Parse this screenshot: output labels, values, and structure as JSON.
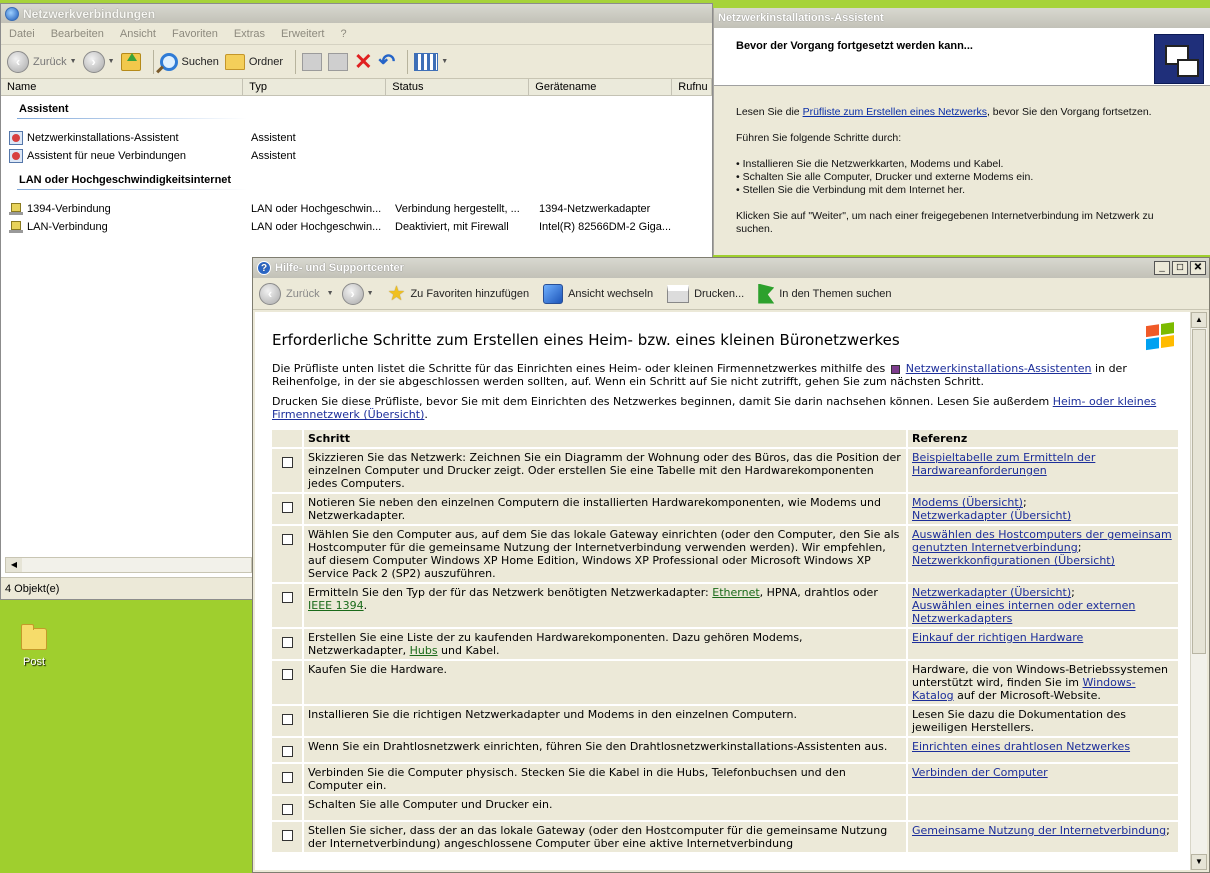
{
  "explorer": {
    "title": "Netzwerkverbindungen",
    "menu": [
      "Datei",
      "Bearbeiten",
      "Ansicht",
      "Favoriten",
      "Extras",
      "Erweitert",
      "?"
    ],
    "toolbar": {
      "back": "Zurück",
      "search": "Suchen",
      "folders": "Ordner"
    },
    "columns": [
      "Name",
      "Typ",
      "Status",
      "Gerätename",
      "Rufnu"
    ],
    "groups": [
      {
        "title": "Assistent",
        "items": [
          {
            "name": "Netzwerkinstallations-Assistent",
            "type": "Assistent",
            "status": "",
            "device": ""
          },
          {
            "name": "Assistent für neue Verbindungen",
            "type": "Assistent",
            "status": "",
            "device": ""
          }
        ]
      },
      {
        "title": "LAN oder Hochgeschwindigkeitsinternet",
        "items": [
          {
            "name": "1394-Verbindung",
            "type": "LAN oder Hochgeschwin...",
            "status": "Verbindung hergestellt, ...",
            "device": "1394-Netzwerkadapter"
          },
          {
            "name": "LAN-Verbindung",
            "type": "LAN oder Hochgeschwin...",
            "status": "Deaktiviert, mit Firewall",
            "device": "Intel(R) 82566DM-2 Giga..."
          }
        ]
      }
    ],
    "status": "4 Objekt(e)"
  },
  "desktop": {
    "icon_label": "Post"
  },
  "wizard": {
    "title": "Netzwerkinstallations-Assistent",
    "header": "Bevor der Vorgang fortgesetzt werden kann...",
    "p1_pre": "Lesen Sie die ",
    "p1_link": "Prüfliste zum Erstellen eines Netzwerks",
    "p1_post": ", bevor Sie den Vorgang fortsetzen.",
    "p2": "Führen Sie folgende Schritte durch:",
    "bullets": [
      "Installieren Sie die Netzwerkkarten, Modems und Kabel.",
      "Schalten Sie alle Computer, Drucker und externe Modems ein.",
      "Stellen Sie die Verbindung mit dem Internet her."
    ],
    "p3": "Klicken Sie auf \"Weiter\", um nach einer freigegebenen Internetverbindung im Netzwerk zu suchen."
  },
  "help": {
    "title": "Hilfe- und Supportcenter",
    "toolbar": {
      "back": "Zurück",
      "favorites": "Zu Favoriten hinzufügen",
      "switch_view": "Ansicht wechseln",
      "print": "Drucken...",
      "find_topics": "In den Themen suchen"
    },
    "heading": "Erforderliche Schritte zum Erstellen eines Heim- bzw. eines kleinen Büronetzwerkes",
    "intro_pre": "Die Prüfliste unten listet die Schritte für das Einrichten eines Heim- oder kleinen Firmennetzwerkes mithilfe des",
    "intro_link": "Netzwerkinstallations-Assistenten",
    "intro_post": "in der Reihenfolge, in der sie abgeschlossen werden sollten, auf. Wenn ein Schritt auf Sie nicht zutrifft, gehen Sie zum nächsten Schritt.",
    "print_pre": "Drucken Sie diese Prüfliste, bevor Sie mit dem Einrichten des Netzwerkes beginnen, damit Sie darin nachsehen können. Lesen Sie außerdem",
    "print_link": "Heim- oder kleines Firmennetzwerk (Übersicht)",
    "print_post": ".",
    "table": {
      "col_step": "Schritt",
      "col_ref": "Referenz",
      "rows": [
        {
          "step": [
            "Skizzieren Sie das Netzwerk: Zeichnen Sie ein Diagramm der Wohnung oder des Büros, das die Position der einzelnen Computer und Drucker zeigt. Oder erstellen Sie eine Tabelle mit den Hardwarekomponenten jedes Computers."
          ],
          "ref": [
            {
              "text": "Beispieltabelle zum Ermitteln der Hardwareanforderungen",
              "link": true
            }
          ]
        },
        {
          "step": [
            "Notieren Sie neben den einzelnen Computern die installierten Hardwarekomponenten, wie Modems und Netzwerkadapter."
          ],
          "ref": [
            {
              "text": "Modems (Übersicht)",
              "link": true
            },
            {
              "text": ";",
              "link": false
            },
            {
              "text": "Netzwerkadapter (Übersicht)",
              "link": true,
              "br": true
            }
          ]
        },
        {
          "step": [
            "Wählen Sie den Computer aus, auf dem Sie das lokale Gateway einrichten (oder den Computer, den Sie als Hostcomputer für die gemeinsame Nutzung der Internetverbindung verwenden werden). Wir empfehlen, auf diesem Computer Windows XP Home Edition, Windows XP Professional oder Microsoft Windows XP Service Pack 2 (SP2) auszuführen."
          ],
          "ref": [
            {
              "text": "Auswählen des Hostcomputers der gemeinsam genutzten Internetverbindung",
              "link": true
            },
            {
              "text": ";",
              "link": false
            },
            {
              "text": "Netzwerkkonfigurationen (Übersicht)",
              "link": true,
              "br": true
            }
          ]
        },
        {
          "step_parts": [
            {
              "text": "Ermitteln Sie den Typ der für das Netzwerk benötigten Netzwerkadapter: "
            },
            {
              "text": "Ethernet",
              "green": true
            },
            {
              "text": ", HPNA, drahtlos oder "
            },
            {
              "text": "IEEE 1394",
              "green": true
            },
            {
              "text": "."
            }
          ],
          "ref": [
            {
              "text": "Netzwerkadapter (Übersicht)",
              "link": true
            },
            {
              "text": ";",
              "link": false
            },
            {
              "text": "Auswählen eines internen oder externen Netzwerkadapters",
              "link": true,
              "br": true
            }
          ]
        },
        {
          "step_parts": [
            {
              "text": "Erstellen Sie eine Liste der zu kaufenden Hardwarekomponenten. Dazu gehören Modems, Netzwerkadapter, "
            },
            {
              "text": "Hubs",
              "green": true
            },
            {
              "text": " und Kabel."
            }
          ],
          "ref": [
            {
              "text": "Einkauf der richtigen Hardware",
              "link": true
            }
          ]
        },
        {
          "step": [
            "Kaufen Sie die Hardware."
          ],
          "ref": [
            {
              "text": "Hardware, die von Windows-Betriebssystemen unterstützt wird, finden Sie im ",
              "link": false
            },
            {
              "text": "Windows-Katalog",
              "link": true
            },
            {
              "text": " auf der Microsoft-Website.",
              "link": false
            }
          ]
        },
        {
          "step": [
            "Installieren Sie die richtigen Netzwerkadapter und Modems in den einzelnen Computern."
          ],
          "ref": [
            {
              "text": "Lesen Sie dazu die Dokumentation des jeweiligen Herstellers.",
              "link": false
            }
          ]
        },
        {
          "step": [
            "Wenn Sie ein Drahtlosnetzwerk einrichten, führen Sie den Drahtlosnetzwerkinstallations-Assistenten aus."
          ],
          "ref": [
            {
              "text": "Einrichten eines drahtlosen Netzwerkes",
              "link": true
            }
          ]
        },
        {
          "step": [
            "Verbinden Sie die Computer physisch. Stecken Sie die Kabel in die Hubs, Telefonbuchsen und den Computer ein."
          ],
          "ref": [
            {
              "text": "Verbinden der Computer",
              "link": true
            }
          ]
        },
        {
          "step": [
            "Schalten Sie alle Computer und Drucker ein."
          ],
          "ref": []
        },
        {
          "step": [
            "Stellen Sie sicher, dass der an das lokale Gateway (oder den Hostcomputer für die gemeinsame Nutzung der Internetverbindung) angeschlossene Computer über eine aktive Internetverbindung"
          ],
          "ref": [
            {
              "text": "Gemeinsame Nutzung der Internetverbindung",
              "link": true
            },
            {
              "text": ";",
              "link": false
            }
          ]
        }
      ]
    }
  }
}
